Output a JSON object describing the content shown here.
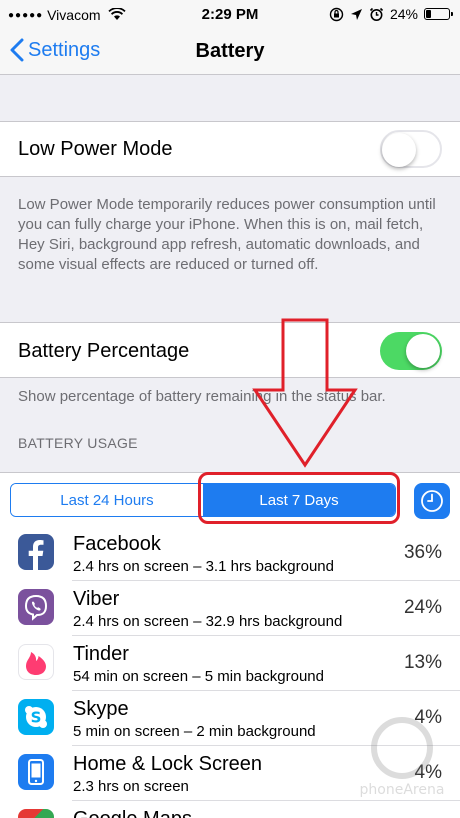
{
  "status_bar": {
    "signal_dots": "●●●●●",
    "carrier": "Vivacom",
    "time": "2:29 PM",
    "battery_percent": "24%",
    "battery_level": 0.24,
    "icons": [
      "wifi-icon",
      "orientation-lock-icon",
      "location-icon",
      "alarm-icon",
      "battery-icon"
    ]
  },
  "nav": {
    "back_label": "Settings",
    "title": "Battery"
  },
  "low_power": {
    "label": "Low Power Mode",
    "enabled": false,
    "description": "Low Power Mode temporarily reduces power consumption until you can fully charge your iPhone. When this is on, mail fetch, Hey Siri, background app refresh, automatic downloads, and some visual effects are reduced or turned off."
  },
  "battery_percentage": {
    "label": "Battery Percentage",
    "enabled": true,
    "description": "Show percentage of battery remaining in the status bar."
  },
  "usage": {
    "section_header": "BATTERY USAGE",
    "segments": [
      "Last 24 Hours",
      "Last 7 Days"
    ],
    "selected_segment": "Last 7 Days",
    "apps": [
      {
        "name": "Facebook",
        "detail": "2.4 hrs on screen – 3.1 hrs background",
        "percent": "36%",
        "icon": "facebook-icon",
        "color": "#3b5998"
      },
      {
        "name": "Viber",
        "detail": "2.4 hrs on screen – 32.9 hrs background",
        "percent": "24%",
        "icon": "viber-icon",
        "color": "#7b519d"
      },
      {
        "name": "Tinder",
        "detail": "54 min on screen – 5 min background",
        "percent": "13%",
        "icon": "tinder-icon",
        "color": "#fe3c72"
      },
      {
        "name": "Skype",
        "detail": "5 min on screen – 2 min background",
        "percent": "4%",
        "icon": "skype-icon",
        "color": "#00aff0"
      },
      {
        "name": "Home & Lock Screen",
        "detail": "2.3 hrs on screen",
        "percent": "4%",
        "icon": "home-lock-screen-icon",
        "color": "#1e7cf0"
      },
      {
        "name": "Google Maps",
        "detail": "",
        "percent": "",
        "icon": "google-maps-icon",
        "color": "#34a853"
      }
    ]
  },
  "colors": {
    "accent": "#1e7cf0",
    "toggle_on": "#4cd964",
    "annotation": "#e0202a"
  }
}
